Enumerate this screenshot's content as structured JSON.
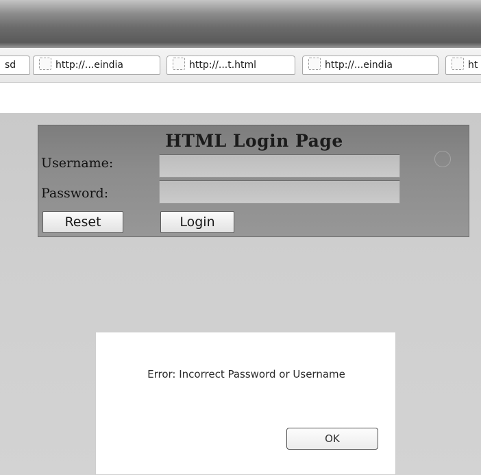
{
  "browser": {
    "tabs": [
      {
        "label": "sd"
      },
      {
        "label": "http://...eindia"
      },
      {
        "label": "http://...t.html"
      },
      {
        "label": "http://...eindia"
      },
      {
        "label": "ht"
      }
    ]
  },
  "login": {
    "title": "HTML Login Page",
    "username_label": "Username:",
    "password_label": "Password:",
    "username_value": "",
    "password_value": "",
    "reset_label": "Reset",
    "login_label": "Login"
  },
  "alert": {
    "message": "Error: Incorrect Password or Username",
    "ok_label": "OK"
  },
  "icons": {
    "tab_favicon": "blank-page-icon"
  },
  "colors": {
    "panel_bg": "#8c8c8c",
    "content_bg": "#cfcfcf",
    "dialog_bg": "#ffffff"
  }
}
